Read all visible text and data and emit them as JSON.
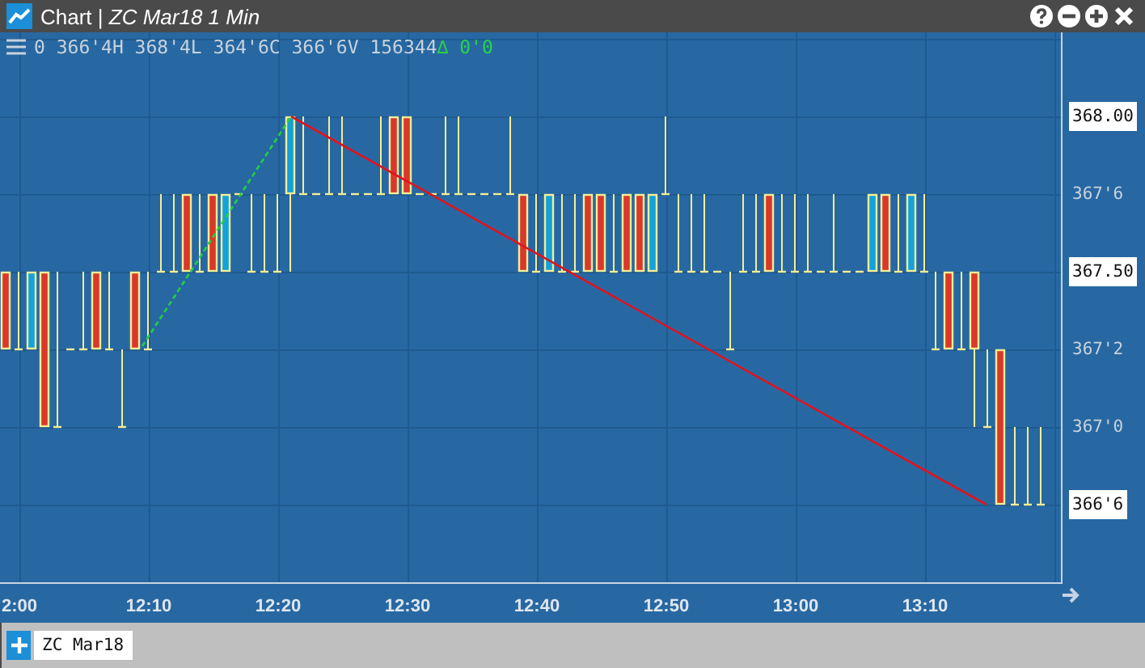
{
  "window": {
    "title": "Chart | *ZC Mar18 1 Min*"
  },
  "info_bar": {
    "quote": "0 366'4H 368'4L 364'6C 366'6V 156344",
    "change": "∆ 0'0"
  },
  "y_axis": [
    {
      "label": "368.00",
      "kind": "boxed"
    },
    {
      "label": "367'6",
      "kind": "plain"
    },
    {
      "label": "367.50",
      "kind": "boxed"
    },
    {
      "label": "367'2",
      "kind": "plain"
    },
    {
      "label": "367'0",
      "kind": "plain"
    },
    {
      "label": "366'6",
      "kind": "boxed"
    }
  ],
  "x_axis": [
    "2:00",
    "12:10",
    "12:20",
    "12:30",
    "12:40",
    "12:50",
    "13:00",
    "13:10"
  ],
  "tabs": [
    {
      "label": "ZC Mar18",
      "selected": true
    }
  ]
}
